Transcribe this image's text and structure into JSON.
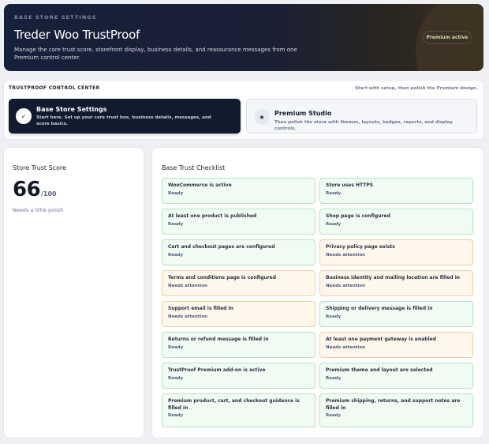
{
  "hero": {
    "kicker": "BASE STORE SETTINGS",
    "title": "Treder Woo TrustProof",
    "description": "Manage the core trust score, storefront display, business details, and reassurance messages from one Premium control center.",
    "badge": "Premium active"
  },
  "control_center": {
    "title": "TRUSTPROOF CONTROL CENTER",
    "hint": "Start with setup, then polish the Premium design.",
    "cards": [
      {
        "icon": "check-icon",
        "glyph": "✓",
        "name": "Base Store Settings",
        "description": "Start here. Set up your core trust box, business details, messages, and score basics."
      },
      {
        "icon": "star-icon",
        "glyph": "★",
        "name": "Premium Studio",
        "description": "Then polish the store with themes, layouts, badges, reports, and display controls."
      }
    ]
  },
  "score": {
    "title": "Store Trust Score",
    "value": "66",
    "max": "/100",
    "note": "Needs a little polish"
  },
  "checklist": {
    "title": "Base Trust Checklist",
    "colors": {
      "ready": "#f0fbf3",
      "attention": "#fff6ec"
    },
    "items": [
      {
        "label": "WooCommerce is active",
        "status": "Ready"
      },
      {
        "label": "Store uses HTTPS",
        "status": "Ready"
      },
      {
        "label": "At least one product is published",
        "status": "Ready"
      },
      {
        "label": "Shop page is configured",
        "status": "Ready"
      },
      {
        "label": "Cart and checkout pages are configured",
        "status": "Ready"
      },
      {
        "label": "Privacy policy page exists",
        "status": "Needs attention"
      },
      {
        "label": "Terms and conditions page is configured",
        "status": "Needs attention"
      },
      {
        "label": "Business identity and mailing location are filled in",
        "status": "Needs attention"
      },
      {
        "label": "Support email is filled in",
        "status": "Needs attention"
      },
      {
        "label": "Shipping or delivery message is filled in",
        "status": "Ready"
      },
      {
        "label": "Returns or refund message is filled in",
        "status": "Ready"
      },
      {
        "label": "At least one payment gateway is enabled",
        "status": "Needs attention"
      },
      {
        "label": "TrustProof Premium add-on is active",
        "status": "Ready"
      },
      {
        "label": "Premium theme and layout are selected",
        "status": "Ready"
      },
      {
        "label": "Premium product, cart, and checkout guidance is filled in",
        "status": "Ready"
      },
      {
        "label": "Premium shipping, returns, and support notes are filled in",
        "status": "Ready"
      }
    ]
  }
}
